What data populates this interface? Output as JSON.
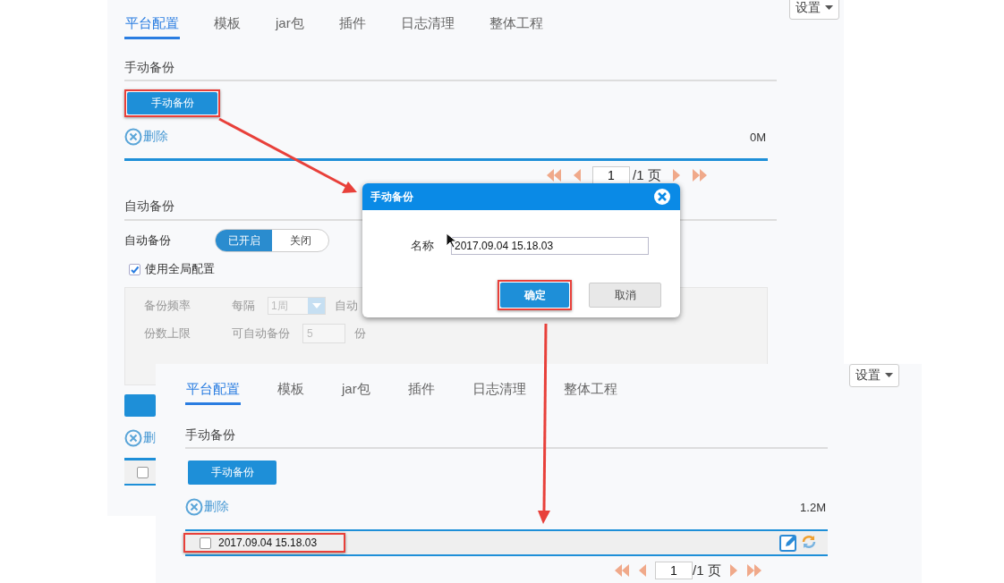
{
  "background_screen": {
    "tabs": [
      {
        "label": "平台配置",
        "selected": true
      },
      {
        "label": "模板",
        "selected": false
      },
      {
        "label": "jar包",
        "selected": false
      },
      {
        "label": "插件",
        "selected": false
      },
      {
        "label": "日志清理",
        "selected": false
      },
      {
        "label": "整体工程",
        "selected": false
      }
    ],
    "settings_button": "设置",
    "manual_backup": {
      "heading": "手动备份",
      "button": {
        "label": "手动备份",
        "highlighted": true
      },
      "delete_label": "删除",
      "size": "0M",
      "pagination": {
        "page": "1",
        "total": "/1 页"
      }
    },
    "auto_backup": {
      "heading": "自动备份",
      "label": "自动备份",
      "toggle": [
        {
          "label": "已开启",
          "selected": true
        },
        {
          "label": "关闭",
          "selected": false
        }
      ],
      "use_global": {
        "label": "使用全局配置",
        "checked": true
      },
      "settings": {
        "disabled": true,
        "rows": [
          {
            "label": "备份频率",
            "prefix": "每隔",
            "kind": "select",
            "value": "1周",
            "suffix": "自动"
          },
          {
            "label": "份数上限",
            "prefix": "可自动备份",
            "kind": "input",
            "value": "5",
            "suffix": "份"
          }
        ]
      }
    },
    "lower_section": {
      "delete_label": "删",
      "rows": [
        {
          "checked": false
        }
      ]
    }
  },
  "foreground_screen": {
    "tabs": [
      {
        "label": "平台配置",
        "selected": true
      },
      {
        "label": "模板",
        "selected": false
      },
      {
        "label": "jar包",
        "selected": false
      },
      {
        "label": "插件",
        "selected": false
      },
      {
        "label": "日志清理",
        "selected": false
      },
      {
        "label": "整体工程",
        "selected": false
      }
    ],
    "settings_button": "设置",
    "manual_backup": {
      "heading": "手动备份",
      "button": {
        "label": "手动备份",
        "highlighted": false
      },
      "delete_label": "删除",
      "size": "1.2M",
      "rows": [
        {
          "name": "2017.09.04 15.18.03",
          "checked": false,
          "highlighted": true
        }
      ],
      "pagination": {
        "page": "1",
        "total": "/1 页"
      }
    }
  },
  "dialog": {
    "title": "手动备份",
    "field_label": "名称",
    "field_value": "2017.09.04 15.18.03",
    "buttons": [
      {
        "label": "确定",
        "kind": "primary",
        "highlighted": true
      },
      {
        "label": "取消",
        "kind": "secondary",
        "highlighted": false
      }
    ]
  }
}
